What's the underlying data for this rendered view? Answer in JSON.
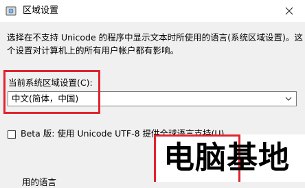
{
  "window": {
    "title": "区域设置",
    "icon": "region-settings-icon",
    "close_icon": "close-icon"
  },
  "description": {
    "line1": "选择在不支持 Unicode 的程序中显示文本时所使用的语言(系统区域设置)。这",
    "line2": "个设置对计算机上的所有用户帐户都有影响。"
  },
  "locale": {
    "label": "当前系统区域设置(C):",
    "selected": "中文(简体，中国)"
  },
  "beta": {
    "label": "Beta 版: 使用 Unicode UTF-8 提供全球语言支持(U)",
    "checked": false
  },
  "bottom_partial_label": "用的语言",
  "watermark": {
    "text": "电脑基地"
  },
  "colors": {
    "highlight": "#e0232e",
    "background": "#f0f0f0"
  }
}
